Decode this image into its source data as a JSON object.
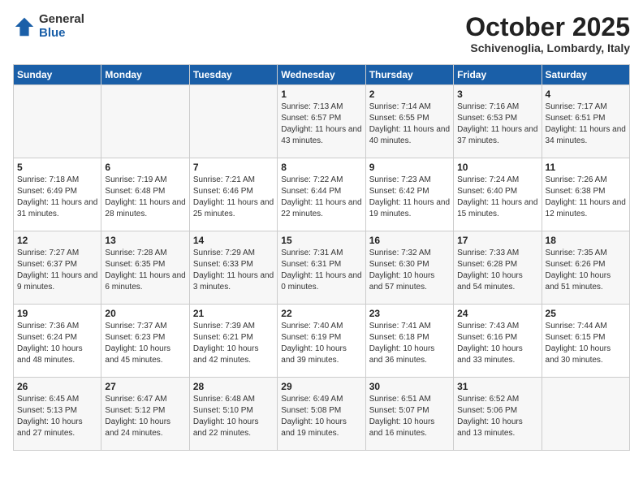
{
  "logo": {
    "general": "General",
    "blue": "Blue"
  },
  "title": {
    "month": "October 2025",
    "location": "Schivenoglia, Lombardy, Italy"
  },
  "headers": [
    "Sunday",
    "Monday",
    "Tuesday",
    "Wednesday",
    "Thursday",
    "Friday",
    "Saturday"
  ],
  "weeks": [
    [
      {
        "day": "",
        "info": ""
      },
      {
        "day": "",
        "info": ""
      },
      {
        "day": "",
        "info": ""
      },
      {
        "day": "1",
        "info": "Sunrise: 7:13 AM\nSunset: 6:57 PM\nDaylight: 11 hours and 43 minutes."
      },
      {
        "day": "2",
        "info": "Sunrise: 7:14 AM\nSunset: 6:55 PM\nDaylight: 11 hours and 40 minutes."
      },
      {
        "day": "3",
        "info": "Sunrise: 7:16 AM\nSunset: 6:53 PM\nDaylight: 11 hours and 37 minutes."
      },
      {
        "day": "4",
        "info": "Sunrise: 7:17 AM\nSunset: 6:51 PM\nDaylight: 11 hours and 34 minutes."
      }
    ],
    [
      {
        "day": "5",
        "info": "Sunrise: 7:18 AM\nSunset: 6:49 PM\nDaylight: 11 hours and 31 minutes."
      },
      {
        "day": "6",
        "info": "Sunrise: 7:19 AM\nSunset: 6:48 PM\nDaylight: 11 hours and 28 minutes."
      },
      {
        "day": "7",
        "info": "Sunrise: 7:21 AM\nSunset: 6:46 PM\nDaylight: 11 hours and 25 minutes."
      },
      {
        "day": "8",
        "info": "Sunrise: 7:22 AM\nSunset: 6:44 PM\nDaylight: 11 hours and 22 minutes."
      },
      {
        "day": "9",
        "info": "Sunrise: 7:23 AM\nSunset: 6:42 PM\nDaylight: 11 hours and 19 minutes."
      },
      {
        "day": "10",
        "info": "Sunrise: 7:24 AM\nSunset: 6:40 PM\nDaylight: 11 hours and 15 minutes."
      },
      {
        "day": "11",
        "info": "Sunrise: 7:26 AM\nSunset: 6:38 PM\nDaylight: 11 hours and 12 minutes."
      }
    ],
    [
      {
        "day": "12",
        "info": "Sunrise: 7:27 AM\nSunset: 6:37 PM\nDaylight: 11 hours and 9 minutes."
      },
      {
        "day": "13",
        "info": "Sunrise: 7:28 AM\nSunset: 6:35 PM\nDaylight: 11 hours and 6 minutes."
      },
      {
        "day": "14",
        "info": "Sunrise: 7:29 AM\nSunset: 6:33 PM\nDaylight: 11 hours and 3 minutes."
      },
      {
        "day": "15",
        "info": "Sunrise: 7:31 AM\nSunset: 6:31 PM\nDaylight: 11 hours and 0 minutes."
      },
      {
        "day": "16",
        "info": "Sunrise: 7:32 AM\nSunset: 6:30 PM\nDaylight: 10 hours and 57 minutes."
      },
      {
        "day": "17",
        "info": "Sunrise: 7:33 AM\nSunset: 6:28 PM\nDaylight: 10 hours and 54 minutes."
      },
      {
        "day": "18",
        "info": "Sunrise: 7:35 AM\nSunset: 6:26 PM\nDaylight: 10 hours and 51 minutes."
      }
    ],
    [
      {
        "day": "19",
        "info": "Sunrise: 7:36 AM\nSunset: 6:24 PM\nDaylight: 10 hours and 48 minutes."
      },
      {
        "day": "20",
        "info": "Sunrise: 7:37 AM\nSunset: 6:23 PM\nDaylight: 10 hours and 45 minutes."
      },
      {
        "day": "21",
        "info": "Sunrise: 7:39 AM\nSunset: 6:21 PM\nDaylight: 10 hours and 42 minutes."
      },
      {
        "day": "22",
        "info": "Sunrise: 7:40 AM\nSunset: 6:19 PM\nDaylight: 10 hours and 39 minutes."
      },
      {
        "day": "23",
        "info": "Sunrise: 7:41 AM\nSunset: 6:18 PM\nDaylight: 10 hours and 36 minutes."
      },
      {
        "day": "24",
        "info": "Sunrise: 7:43 AM\nSunset: 6:16 PM\nDaylight: 10 hours and 33 minutes."
      },
      {
        "day": "25",
        "info": "Sunrise: 7:44 AM\nSunset: 6:15 PM\nDaylight: 10 hours and 30 minutes."
      }
    ],
    [
      {
        "day": "26",
        "info": "Sunrise: 6:45 AM\nSunset: 5:13 PM\nDaylight: 10 hours and 27 minutes."
      },
      {
        "day": "27",
        "info": "Sunrise: 6:47 AM\nSunset: 5:12 PM\nDaylight: 10 hours and 24 minutes."
      },
      {
        "day": "28",
        "info": "Sunrise: 6:48 AM\nSunset: 5:10 PM\nDaylight: 10 hours and 22 minutes."
      },
      {
        "day": "29",
        "info": "Sunrise: 6:49 AM\nSunset: 5:08 PM\nDaylight: 10 hours and 19 minutes."
      },
      {
        "day": "30",
        "info": "Sunrise: 6:51 AM\nSunset: 5:07 PM\nDaylight: 10 hours and 16 minutes."
      },
      {
        "day": "31",
        "info": "Sunrise: 6:52 AM\nSunset: 5:06 PM\nDaylight: 10 hours and 13 minutes."
      },
      {
        "day": "",
        "info": ""
      }
    ]
  ]
}
